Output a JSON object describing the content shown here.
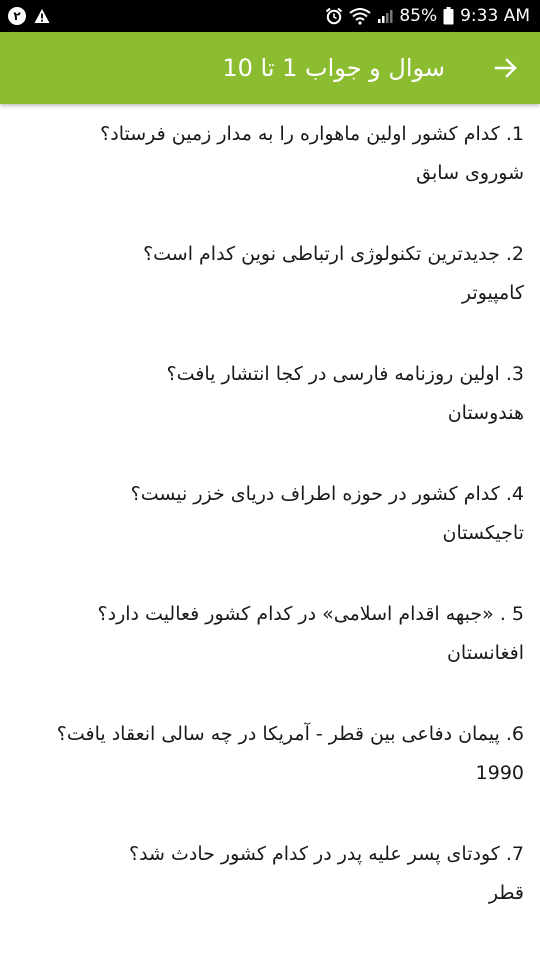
{
  "status_bar": {
    "notification_count": "۲",
    "battery_percent": "85%",
    "time": "9:33 AM",
    "icons": [
      "notification-count-icon",
      "warning-icon",
      "alarm-icon",
      "wifi-icon",
      "signal-icon",
      "battery-icon"
    ]
  },
  "app_bar": {
    "title": "سوال و جواب 1 تا 10",
    "back_icon": "arrow-right-icon",
    "color": "#8cbc2f"
  },
  "qa_items": [
    {
      "question": "1. کدام کشور اولین ماهواره را به مدار زمین فرستاد؟",
      "answer": "شوروی سابق"
    },
    {
      "question": "2. جدیدترین تکنولوژی ارتباطی نوین کدام است؟",
      "answer": "کامپیوتر"
    },
    {
      "question": "3. اولین روزنامه فارسی در کجا انتشار یافت؟",
      "answer": "هندوستان"
    },
    {
      "question": "4. کدام کشور در حوزه اطراف دریای خزر نیست؟",
      "answer": "تاجیکستان"
    },
    {
      "question": "5 . «جبهه اقدام اسلامی» در کدام کشور فعالیت دارد؟",
      "answer": "افغانستان"
    },
    {
      "question": "6. پیمان دفاعی بین قطر - آمریکا در چه سالی انعقاد یافت؟",
      "answer": "1990"
    },
    {
      "question": "7. کودتای پسر علیه پدر در کدام کشور حادث شد؟",
      "answer": "قطر"
    }
  ]
}
